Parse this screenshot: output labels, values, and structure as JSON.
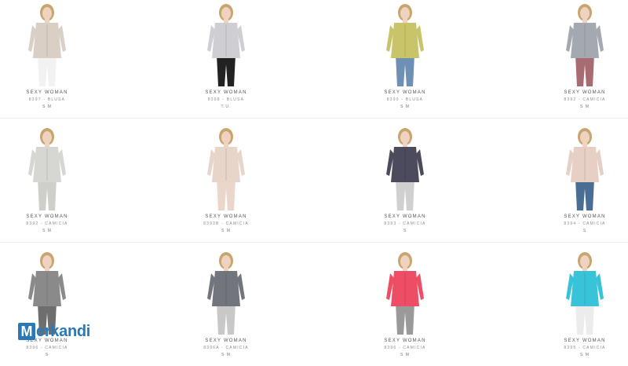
{
  "products": [
    {
      "brand": "SEXY WOMAN",
      "code": "8397 - BLUSA",
      "sizes": "S M",
      "top_color": "#d9cfc4",
      "bottom_color": "#f2f2f2"
    },
    {
      "brand": "SEXY WOMAN",
      "code": "8398 - BLUSA",
      "sizes": "T.U.",
      "top_color": "#cfcfd3",
      "bottom_color": "#222222"
    },
    {
      "brand": "SEXY WOMAN",
      "code": "8390 - BLUSA",
      "sizes": "S M",
      "top_color": "#c9c46a",
      "bottom_color": "#6f90b5"
    },
    {
      "brand": "SEXY WOMAN",
      "code": "8392 - CAMICIA",
      "sizes": "S M",
      "top_color": "#a4a8b1",
      "bottom_color": "#a86b72"
    },
    {
      "brand": "SEXY WOMAN",
      "code": "8392 - CAMICIA",
      "sizes": "S M",
      "top_color": "#d6d6d2",
      "bottom_color": "#cfcfc9"
    },
    {
      "brand": "SEXY WOMAN",
      "code": "8393B - CAMICIA",
      "sizes": "S M",
      "top_color": "#e6d5c8",
      "bottom_color": "#ead6cb"
    },
    {
      "brand": "SEXY WOMAN",
      "code": "8393 - CAMICIA",
      "sizes": "S",
      "top_color": "#4b4b5d",
      "bottom_color": "#d0d0d0"
    },
    {
      "brand": "SEXY WOMAN",
      "code": "8394 - CAMICIA",
      "sizes": "S",
      "top_color": "#e7cfc5",
      "bottom_color": "#4a6d93"
    },
    {
      "brand": "SEXY WOMAN",
      "code": "8396 - CAMICIA",
      "sizes": "S",
      "top_color": "#8a8a8a",
      "bottom_color": "#6e6e6e"
    },
    {
      "brand": "SEXY WOMAN",
      "code": "8396A - CAMICIA",
      "sizes": "S M",
      "top_color": "#72757c",
      "bottom_color": "#c8c8c8"
    },
    {
      "brand": "SEXY WOMAN",
      "code": "8396 - CAMICIA",
      "sizes": "S M",
      "top_color": "#ee4d66",
      "bottom_color": "#9a9a9a"
    },
    {
      "brand": "SEXY WOMAN",
      "code": "8395 - CAMICIA",
      "sizes": "S M",
      "top_color": "#39c3d8",
      "bottom_color": "#ececec"
    }
  ],
  "watermark": {
    "first_letter": "M",
    "rest": "erkandi"
  }
}
